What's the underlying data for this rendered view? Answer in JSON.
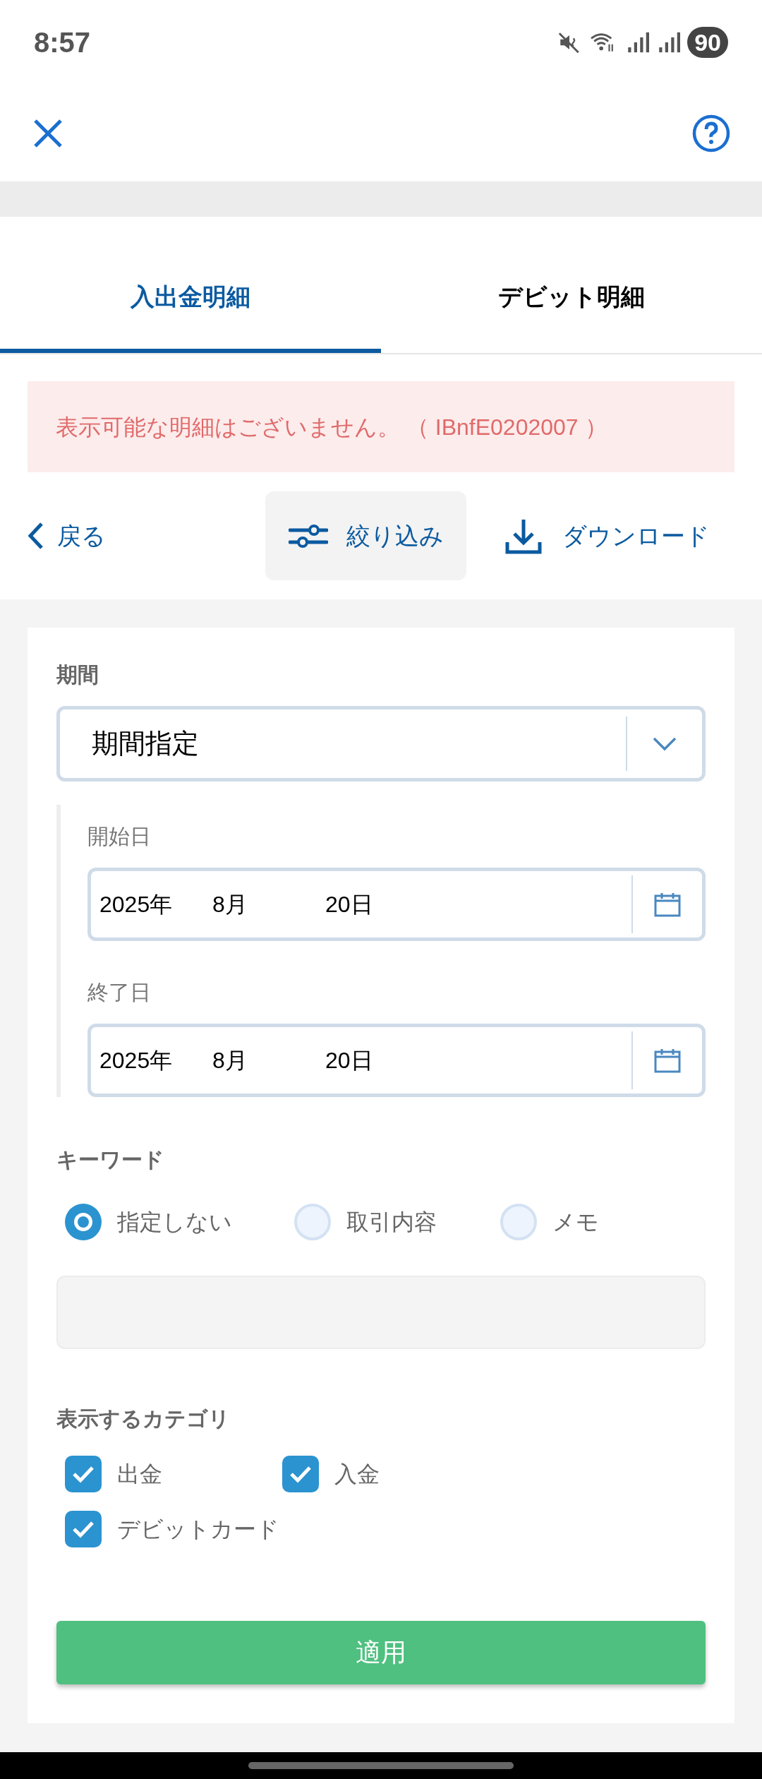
{
  "status_bar": {
    "time": "8:57",
    "battery": "90"
  },
  "tabs": [
    {
      "label": "入出金明細",
      "selected": true
    },
    {
      "label": "デビット明細",
      "selected": false
    }
  ],
  "error_banner": "表示可能な明細はございません。 （ IBnfE0202007 ）",
  "toolbar": {
    "back": "戻る",
    "filter": "絞り込み",
    "download": "ダウンロード"
  },
  "period": {
    "label": "期間",
    "value": "期間指定",
    "dates": [
      {
        "label": "開始日",
        "year": "2025年",
        "month": "8月",
        "day": "20日"
      },
      {
        "label": "終了日",
        "year": "2025年",
        "month": "8月",
        "day": "20日"
      }
    ]
  },
  "keyword": {
    "label": "キーワード",
    "options": [
      {
        "label": "指定しない",
        "selected": true
      },
      {
        "label": "取引内容",
        "selected": false
      },
      {
        "label": "メモ",
        "selected": false
      }
    ]
  },
  "categories": {
    "label": "表示するカテゴリ",
    "items": [
      {
        "label": "出金",
        "checked": true
      },
      {
        "label": "入金",
        "checked": true
      },
      {
        "label": "デビットカード",
        "checked": true
      }
    ]
  },
  "apply_button": "適用"
}
